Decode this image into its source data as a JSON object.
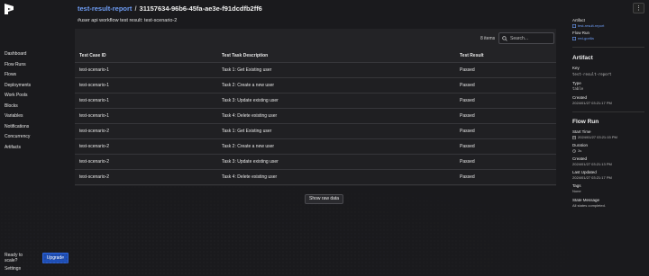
{
  "sidebar": {
    "items": [
      "Dashboard",
      "Flow Runs",
      "Flows",
      "Deployments",
      "Work Pools",
      "Blocks",
      "Variables",
      "Notifications",
      "Concurrency",
      "Artifacts"
    ],
    "scale_text": "Ready to scale?",
    "upgrade_label": "Upgrade",
    "settings_label": "Settings"
  },
  "header": {
    "crumb_link": "test-result-report",
    "crumb_sep": "/",
    "crumb_id": "31157634-96b6-45fa-ae3e-f91dcdfb2ff6",
    "subtitle": "#user api workflow test result: test-scenario-2",
    "menu_icon": "ellipsis-vertical-icon"
  },
  "table": {
    "count_label": "8 items",
    "search_placeholder": "Search...",
    "columns": [
      "Test Case ID",
      "Test Task Description",
      "Test Result"
    ],
    "rows": [
      [
        "test-scenario-1",
        "Task 1: Get Existing user",
        "Passed"
      ],
      [
        "test-scenario-1",
        "Task 2: Create a new user",
        "Passed"
      ],
      [
        "test-scenario-1",
        "Task 3: Update existing user",
        "Passed"
      ],
      [
        "test-scenario-1",
        "Task 4: Delete existing user",
        "Passed"
      ],
      [
        "test-scenario-2",
        "Task 1: Get Existing user",
        "Passed"
      ],
      [
        "test-scenario-2",
        "Task 2: Create a new user",
        "Passed"
      ],
      [
        "test-scenario-2",
        "Task 3: Update existing user",
        "Passed"
      ],
      [
        "test-scenario-2",
        "Task 4: Delete existing user",
        "Passed"
      ]
    ],
    "raw_button": "Show raw data"
  },
  "details": {
    "artifact_label": "Artifact",
    "artifact_link": "test-result-report",
    "flowrun_label": "Flow Run",
    "flowrun_link": "red-gorilla",
    "artifact_heading": "Artifact",
    "key_label": "Key",
    "key_value": "test-result-report",
    "type_label": "Type",
    "type_value": "table",
    "created_label": "Created",
    "created_value": "2024/01/27 03:21:17 PM",
    "flowrun_heading": "Flow Run",
    "start_label": "Start Time",
    "start_value": "2024/01/27 03:21:15 PM",
    "duration_label": "Duration",
    "duration_value": "3s",
    "fr_created_label": "Created",
    "fr_created_value": "2024/01/27 03:21:13 PM",
    "updated_label": "Last Updated",
    "updated_value": "2024/01/27 03:21:17 PM",
    "tags_label": "Tags",
    "tags_value": "None",
    "state_label": "State Message",
    "state_value": "All states completed."
  },
  "colors": {
    "background": "#1a1a1d",
    "link": "#6f9ef7",
    "upgrade": "#1e4fb8"
  }
}
